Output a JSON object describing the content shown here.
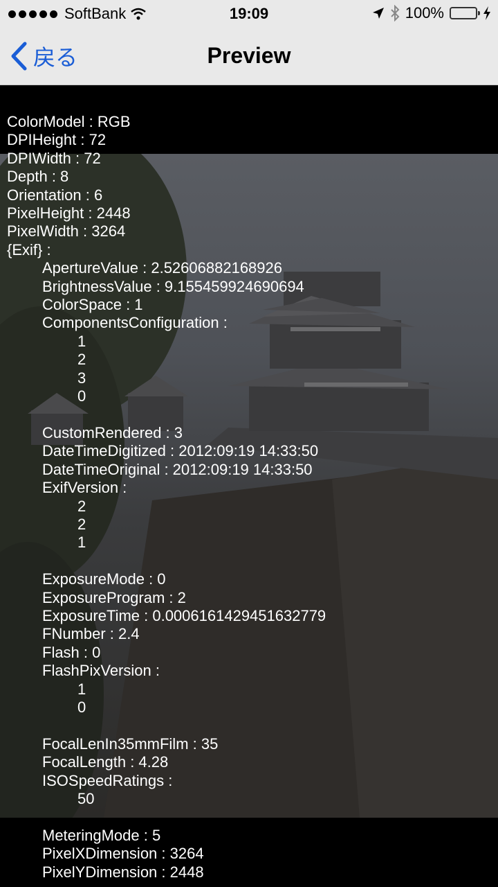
{
  "status_bar": {
    "carrier": "SoftBank",
    "time": "19:09",
    "battery": "100%"
  },
  "nav": {
    "back_label": "戻る",
    "title": "Preview"
  },
  "metadata": {
    "color_model": "ColorModel : RGB",
    "dpi_height": "DPIHeight : 72",
    "dpi_width": "DPIWidth : 72",
    "depth": "Depth : 8",
    "orientation": "Orientation : 6",
    "pixel_height": "PixelHeight : 2448",
    "pixel_width": "PixelWidth : 3264",
    "exif_header": "{Exif} :",
    "aperture": "ApertureValue : 2.52606882168926",
    "brightness": "BrightnessValue : 9.155459924690694",
    "color_space": "ColorSpace : 1",
    "components_config": "ComponentsConfiguration :",
    "components_values": [
      "1",
      "2",
      "3",
      "0"
    ],
    "custom_rendered": "CustomRendered : 3",
    "datetime_digitized": "DateTimeDigitized : 2012:09:19 14:33:50",
    "datetime_original": "DateTimeOriginal : 2012:09:19 14:33:50",
    "exif_version": "ExifVersion :",
    "exif_version_values": [
      "2",
      "2",
      "1"
    ],
    "exposure_mode": "ExposureMode : 0",
    "exposure_program": "ExposureProgram : 2",
    "exposure_time": "ExposureTime : 0.0006161429451632779",
    "fnumber": "FNumber : 2.4",
    "flash": "Flash : 0",
    "flashpix_version": "FlashPixVersion :",
    "flashpix_values": [
      "1",
      "0"
    ],
    "focal_35mm": "FocalLenIn35mmFilm : 35",
    "focal_length": "FocalLength : 4.28",
    "iso": "ISOSpeedRatings :",
    "iso_values": [
      "50"
    ],
    "metering_mode": "MeteringMode : 5",
    "pixel_x_dimension": "PixelXDimension : 3264",
    "pixel_y_dimension": "PixelYDimension : 2448"
  }
}
